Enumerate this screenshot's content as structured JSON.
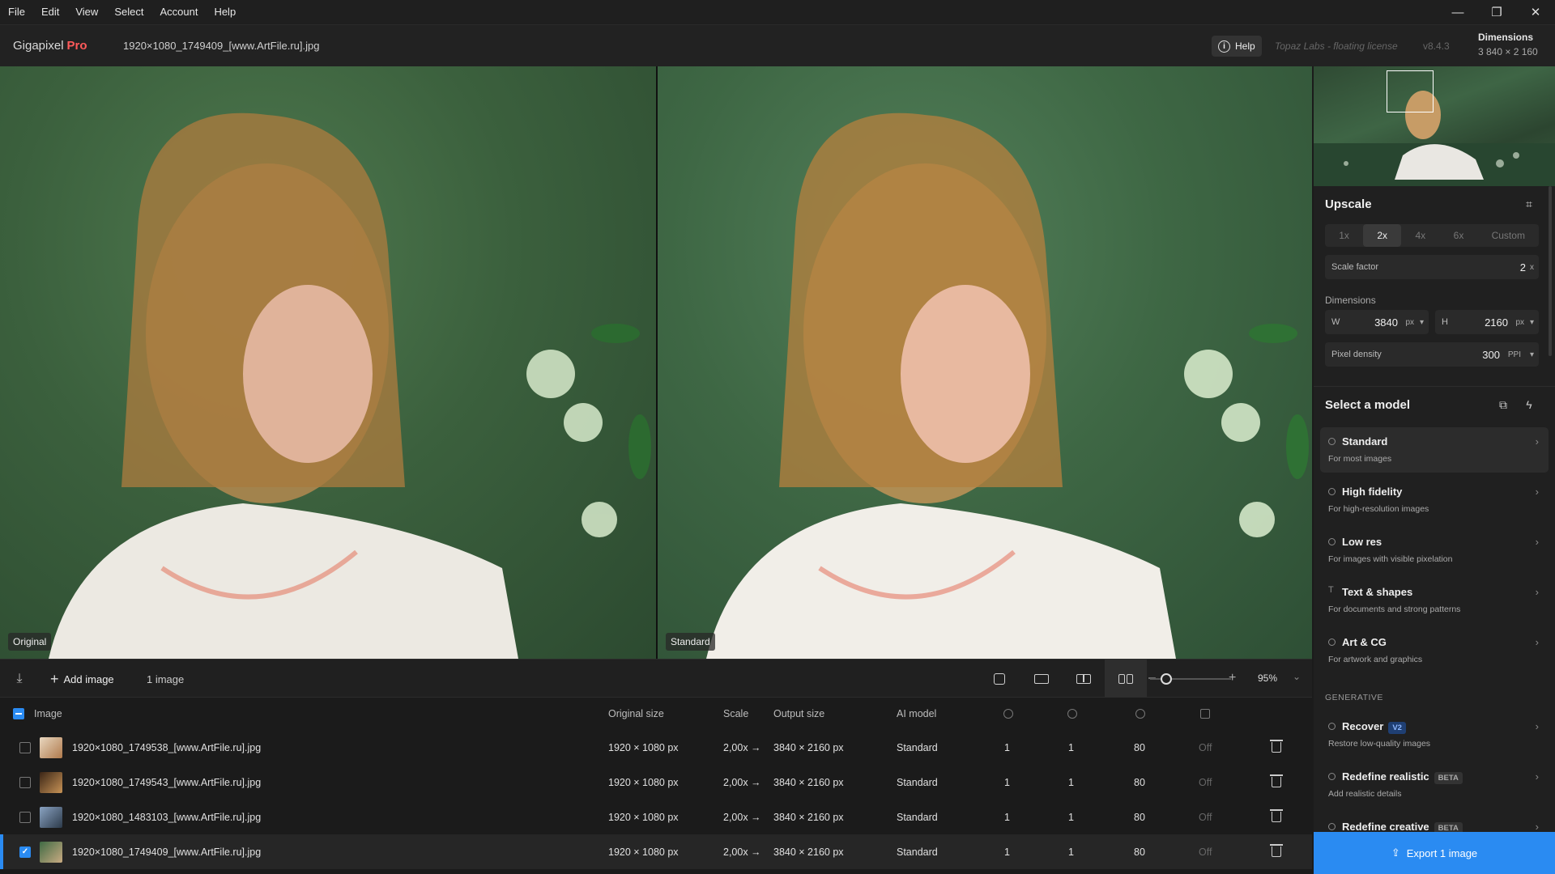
{
  "menu": [
    "File",
    "Edit",
    "View",
    "Select",
    "Account",
    "Help"
  ],
  "window_controls": {
    "minimize": "—",
    "restore": "❐",
    "close": "✕"
  },
  "header": {
    "app_name": "Gigapixel",
    "app_tier": "Pro",
    "file_name": "1920×1080_1749409_[www.ArtFile.ru].jpg",
    "help_label": "Help",
    "license": "Topaz Labs - floating license",
    "version": "v8.4.3",
    "dimensions_title": "Dimensions",
    "dimensions_value": "3 840 × 2 160"
  },
  "viewer": {
    "left_label": "Original",
    "right_label": "Standard"
  },
  "toolbar": {
    "add_image": "Add image",
    "image_count": "1 image",
    "zoom_value": "95%",
    "zoom_level": 0.2
  },
  "table": {
    "headers": {
      "image": "Image",
      "original_size": "Original size",
      "scale": "Scale",
      "output_size": "Output size",
      "ai_model": "AI model"
    },
    "rows": [
      {
        "name": "1920×1080_1749538_[www.ArtFile.ru].jpg",
        "original": "1920 × 1080 px",
        "scale": "2,00x →",
        "output": "3840 × 2160 px",
        "model": "Standard",
        "c1": "1",
        "c2": "1",
        "c3": "80",
        "c4": "Off",
        "checked": false
      },
      {
        "name": "1920×1080_1749543_[www.ArtFile.ru].jpg",
        "original": "1920 × 1080 px",
        "scale": "2,00x →",
        "output": "3840 × 2160 px",
        "model": "Standard",
        "c1": "1",
        "c2": "1",
        "c3": "80",
        "c4": "Off",
        "checked": false
      },
      {
        "name": "1920×1080_1483103_[www.ArtFile.ru].jpg",
        "original": "1920 × 1080 px",
        "scale": "2,00x →",
        "output": "3840 × 2160 px",
        "model": "Standard",
        "c1": "1",
        "c2": "1",
        "c3": "80",
        "c4": "Off",
        "checked": false
      },
      {
        "name": "1920×1080_1749409_[www.ArtFile.ru].jpg",
        "original": "1920 × 1080 px",
        "scale": "2,00x →",
        "output": "3840 × 2160 px",
        "model": "Standard",
        "c1": "1",
        "c2": "1",
        "c3": "80",
        "c4": "Off",
        "checked": true
      }
    ]
  },
  "panel": {
    "upscale_title": "Upscale",
    "scale_options": [
      "1x",
      "2x",
      "4x",
      "6x",
      "Custom"
    ],
    "scale_selected": "2x",
    "scale_factor_label": "Scale factor",
    "scale_factor_value": "2",
    "scale_factor_unit": "x",
    "dimensions_label": "Dimensions",
    "width_label": "W",
    "width_value": "3840",
    "width_unit": "px",
    "height_label": "H",
    "height_value": "2160",
    "height_unit": "px",
    "pixel_density_label": "Pixel density",
    "pixel_density_value": "300",
    "pixel_density_unit": "PPI",
    "select_model_title": "Select a model",
    "models": [
      {
        "name": "Standard",
        "desc": "For most images"
      },
      {
        "name": "High fidelity",
        "desc": "For high-resolution images"
      },
      {
        "name": "Low res",
        "desc": "For images with visible pixelation"
      },
      {
        "name": "Text & shapes",
        "desc": "For documents and strong patterns"
      },
      {
        "name": "Art & CG",
        "desc": "For artwork and graphics"
      }
    ],
    "generative_label": "GENERATIVE",
    "generative_models": [
      {
        "name": "Recover",
        "badge": "V2",
        "desc": "Restore low-quality images"
      },
      {
        "name": "Redefine realistic",
        "badge": "BETA",
        "desc": "Add realistic details"
      },
      {
        "name": "Redefine creative",
        "badge": "BETA",
        "desc": ""
      }
    ],
    "export_label": "Export 1 image"
  },
  "colors": {
    "accent": "#2a8bf2",
    "pro": "#ff5a5a",
    "background": "#1b1b1b"
  }
}
